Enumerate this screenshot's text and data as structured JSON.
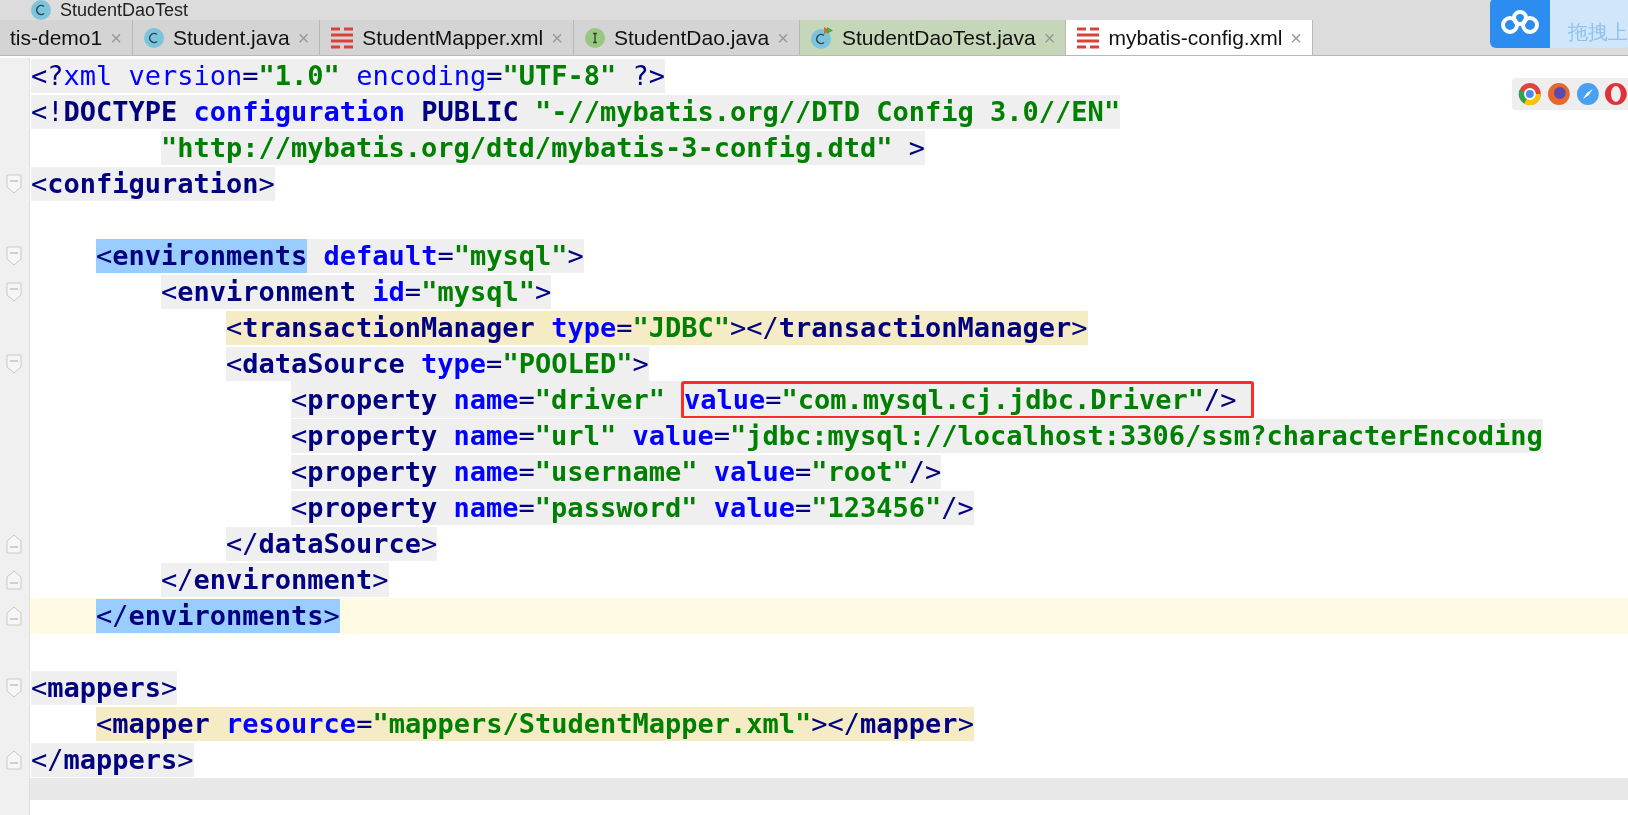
{
  "breadcrumb": {
    "kind": "class",
    "text": "StudentDaoTest"
  },
  "tabs": [
    {
      "label": "tis-demo1",
      "kind": "plain",
      "selected": false,
      "close": "×"
    },
    {
      "label": "Student.java",
      "kind": "class",
      "selected": false,
      "close": "×"
    },
    {
      "label": "StudentMapper.xml",
      "kind": "xml",
      "selected": false,
      "close": "×"
    },
    {
      "label": "StudentDao.java",
      "kind": "interface",
      "selected": false,
      "close": "×"
    },
    {
      "label": "StudentDaoTest.java",
      "kind": "test",
      "selected": false,
      "close": "×"
    },
    {
      "label": "mybatis-config.xml",
      "kind": "xml",
      "selected": true,
      "close": "×"
    }
  ],
  "upload_widget": {
    "text": "拖拽上"
  },
  "code_lines": [
    {
      "kind": "gray",
      "fold_start": false,
      "fold_end": false,
      "current": false,
      "tokens": [
        {
          "kind": "punct",
          "text": "<?"
        },
        {
          "kind": "pi",
          "text": "xml version"
        },
        {
          "kind": "punct",
          "text": "="
        },
        {
          "kind": "value",
          "text": "\"1.0\""
        },
        {
          "kind": "pi",
          "text": " encoding"
        },
        {
          "kind": "punct",
          "text": "="
        },
        {
          "kind": "value",
          "text": "\"UTF-8\""
        },
        {
          "kind": "punct",
          "text": " ?>"
        }
      ]
    },
    {
      "kind": "gray",
      "fold_start": false,
      "fold_end": false,
      "current": false,
      "tokens": [
        {
          "kind": "punct",
          "text": "<!"
        },
        {
          "kind": "tag",
          "text": "DOCTYPE "
        },
        {
          "kind": "attr",
          "text": "configuration "
        },
        {
          "kind": "tag",
          "text": "PUBLIC "
        },
        {
          "kind": "value",
          "text": "\"-//mybatis.org//DTD Config 3.0//EN\""
        }
      ],
      "continuation_tokens": [
        {
          "kind": "value",
          "text": "\"http://mybatis.org/dtd/mybatis-3-config.dtd\""
        },
        {
          "kind": "punct",
          "text": " >"
        }
      ]
    },
    {
      "kind": "gray",
      "fold_start": true,
      "fold_end": false,
      "current": false,
      "tokens": [
        {
          "kind": "punct",
          "text": "<"
        },
        {
          "kind": "tag",
          "text": "configuration"
        },
        {
          "kind": "punct",
          "text": ">"
        }
      ],
      "children": [
        {
          "fold_start": false,
          "fold_end": false,
          "current": false
        },
        {
          "kind": "gray",
          "fold_start": true,
          "fold_end": false,
          "current": false,
          "tokens": [
            {
              "kind": "punct_match",
              "text": "<"
            },
            {
              "kind": "tag_match",
              "text": "environments"
            },
            {
              "kind": "attr",
              "text": " default"
            },
            {
              "kind": "punct",
              "text": "="
            },
            {
              "kind": "value",
              "text": "\"mysql\""
            },
            {
              "kind": "punct",
              "text": ">"
            }
          ],
          "children": [
            {
              "kind": "gray",
              "fold_start": true,
              "fold_end": false,
              "current": false,
              "tokens": [
                {
                  "kind": "punct",
                  "text": "<"
                },
                {
                  "kind": "tag",
                  "text": "environment"
                },
                {
                  "kind": "attr",
                  "text": " id"
                },
                {
                  "kind": "punct",
                  "text": "="
                },
                {
                  "kind": "value",
                  "text": "\"mysql\""
                },
                {
                  "kind": "punct",
                  "text": ">"
                }
              ],
              "children": [
                {
                  "kind": "tan",
                  "fold_start": false,
                  "fold_end": false,
                  "current": false,
                  "tokens": [
                    {
                      "kind": "punct",
                      "text": "<"
                    },
                    {
                      "kind": "tag",
                      "text": "transactionManager"
                    },
                    {
                      "kind": "attr",
                      "text": " type"
                    },
                    {
                      "kind": "punct",
                      "text": "="
                    },
                    {
                      "kind": "value",
                      "text": "\"JDBC\""
                    },
                    {
                      "kind": "punct",
                      "text": "></"
                    },
                    {
                      "kind": "tag",
                      "text": "transactionManager"
                    },
                    {
                      "kind": "punct",
                      "text": ">"
                    }
                  ]
                },
                {
                  "kind": "gray",
                  "fold_start": true,
                  "fold_end": false,
                  "current": false,
                  "tokens": [
                    {
                      "kind": "punct",
                      "text": "<"
                    },
                    {
                      "kind": "tag",
                      "text": "dataSource"
                    },
                    {
                      "kind": "attr",
                      "text": " type"
                    },
                    {
                      "kind": "punct",
                      "text": "="
                    },
                    {
                      "kind": "value",
                      "text": "\"POOLED\""
                    },
                    {
                      "kind": "punct",
                      "text": ">"
                    }
                  ],
                  "children": [
                    {
                      "kind": "gray",
                      "fold_start": false,
                      "fold_end": false,
                      "current": false,
                      "tokens": [
                        {
                          "kind": "punct",
                          "text": "<"
                        },
                        {
                          "kind": "tag",
                          "text": "property"
                        },
                        {
                          "kind": "attr",
                          "text": " name"
                        },
                        {
                          "kind": "punct",
                          "text": "="
                        },
                        {
                          "kind": "value",
                          "text": "\"driver\""
                        }
                      ],
                      "annotated_tokens": [
                        {
                          "kind": "attr",
                          "text": "value"
                        },
                        {
                          "kind": "punct",
                          "text": "="
                        },
                        {
                          "kind": "value",
                          "text": "\"com.mysql.cj.jdbc.Driver\""
                        },
                        {
                          "kind": "punct",
                          "text": "/>"
                        }
                      ]
                    },
                    {
                      "kind": "gray",
                      "fold_start": false,
                      "fold_end": false,
                      "current": false,
                      "tokens": [
                        {
                          "kind": "punct",
                          "text": "<"
                        },
                        {
                          "kind": "tag",
                          "text": "property"
                        },
                        {
                          "kind": "attr",
                          "text": " name"
                        },
                        {
                          "kind": "punct",
                          "text": "="
                        },
                        {
                          "kind": "value",
                          "text": "\"url\""
                        },
                        {
                          "kind": "attr",
                          "text": " value"
                        },
                        {
                          "kind": "punct",
                          "text": "="
                        },
                        {
                          "kind": "value",
                          "text": "\"jdbc:mysql://localhost:3306/ssm?characterEncoding"
                        }
                      ]
                    },
                    {
                      "kind": "gray",
                      "fold_start": false,
                      "fold_end": false,
                      "current": false,
                      "tokens": [
                        {
                          "kind": "punct",
                          "text": "<"
                        },
                        {
                          "kind": "tag",
                          "text": "property"
                        },
                        {
                          "kind": "attr",
                          "text": " name"
                        },
                        {
                          "kind": "punct",
                          "text": "="
                        },
                        {
                          "kind": "value",
                          "text": "\"username\""
                        },
                        {
                          "kind": "attr",
                          "text": " value"
                        },
                        {
                          "kind": "punct",
                          "text": "="
                        },
                        {
                          "kind": "value",
                          "text": "\"root\""
                        },
                        {
                          "kind": "punct",
                          "text": "/>"
                        }
                      ]
                    },
                    {
                      "kind": "gray",
                      "fold_start": false,
                      "fold_end": false,
                      "current": false,
                      "tokens": [
                        {
                          "kind": "punct",
                          "text": "<"
                        },
                        {
                          "kind": "tag",
                          "text": "property"
                        },
                        {
                          "kind": "attr",
                          "text": " name"
                        },
                        {
                          "kind": "punct",
                          "text": "="
                        },
                        {
                          "kind": "value",
                          "text": "\"password\""
                        },
                        {
                          "kind": "attr",
                          "text": " value"
                        },
                        {
                          "kind": "punct",
                          "text": "="
                        },
                        {
                          "kind": "value",
                          "text": "\"123456\""
                        },
                        {
                          "kind": "punct",
                          "text": "/>"
                        }
                      ]
                    }
                  ]
                },
                {
                  "kind": "gray",
                  "fold_start": false,
                  "fold_end": true,
                  "current": false,
                  "tokens": [
                    {
                      "kind": "punct",
                      "text": "</"
                    },
                    {
                      "kind": "tag",
                      "text": "dataSource"
                    },
                    {
                      "kind": "punct",
                      "text": ">"
                    }
                  ]
                }
              ]
            },
            {
              "kind": "gray",
              "fold_start": false,
              "fold_end": true,
              "current": false,
              "tokens": [
                {
                  "kind": "punct",
                  "text": "</"
                },
                {
                  "kind": "tag",
                  "text": "environment"
                },
                {
                  "kind": "punct",
                  "text": ">"
                }
              ]
            }
          ]
        },
        {
          "kind": "plain",
          "fold_start": false,
          "fold_end": true,
          "current": true,
          "tokens": [
            {
              "kind": "punct_match",
              "text": "</"
            },
            {
              "kind": "tag_match",
              "text": "environments"
            },
            {
              "kind": "punct_match",
              "text": ">"
            }
          ]
        }
      ]
    },
    {
      "fold_start": false,
      "fold_end": false,
      "current": false
    },
    {
      "kind": "gray",
      "fold_start": true,
      "fold_end": false,
      "current": false,
      "tokens": [
        {
          "kind": "punct",
          "text": "<"
        },
        {
          "kind": "tag",
          "text": "mappers"
        },
        {
          "kind": "punct",
          "text": ">"
        }
      ],
      "children": [
        {
          "kind": "tan",
          "fold_start": false,
          "fold_end": false,
          "current": false,
          "tokens": [
            {
              "kind": "punct",
              "text": "<"
            },
            {
              "kind": "tag",
              "text": "mapper"
            },
            {
              "kind": "attr",
              "text": " resource"
            },
            {
              "kind": "punct",
              "text": "="
            },
            {
              "kind": "value",
              "text": "\"mappers/StudentMapper.xml\""
            },
            {
              "kind": "punct",
              "text": "></"
            },
            {
              "kind": "tag",
              "text": "mapper"
            },
            {
              "kind": "punct",
              "text": ">"
            }
          ]
        }
      ]
    },
    {
      "kind": "gray",
      "fold_start": false,
      "fold_end": true,
      "current": false,
      "tokens": [
        {
          "kind": "punct",
          "text": "</"
        },
        {
          "kind": "tag",
          "text": "mappers"
        },
        {
          "kind": "punct",
          "text": ">"
        }
      ]
    }
  ]
}
